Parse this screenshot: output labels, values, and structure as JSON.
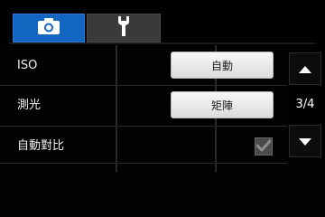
{
  "tabs": [
    {
      "icon": "camera-icon",
      "active": true
    },
    {
      "icon": "wrench-icon",
      "active": false
    }
  ],
  "settings": {
    "iso": {
      "label": "ISO",
      "value": "自動"
    },
    "metering": {
      "label": "測光",
      "value": "矩陣"
    },
    "auto_contrast": {
      "label": "自動對比",
      "checked": true
    }
  },
  "pager": {
    "indicator": "3/4"
  },
  "colors": {
    "active_tab": "#1366c0",
    "inactive_tab": "#3a3a3a",
    "background": "#000000"
  }
}
